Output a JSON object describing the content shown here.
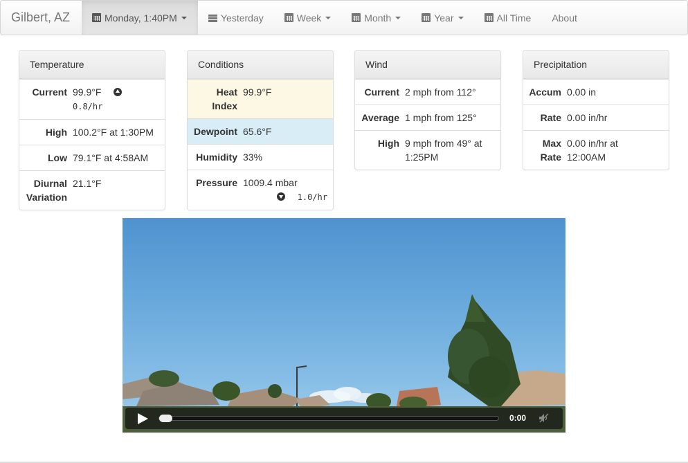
{
  "navbar": {
    "brand": "Gilbert, AZ",
    "items": [
      {
        "label": "Monday, 1:40PM",
        "icon": "calendar-icon",
        "dropdown": true,
        "active": true
      },
      {
        "label": "Yesterday",
        "icon": "list-icon",
        "dropdown": false
      },
      {
        "label": "Week",
        "icon": "calendar-icon",
        "dropdown": true
      },
      {
        "label": "Month",
        "icon": "calendar-icon",
        "dropdown": true
      },
      {
        "label": "Year",
        "icon": "calendar-icon",
        "dropdown": true
      },
      {
        "label": "All Time",
        "icon": "calendar-icon",
        "dropdown": false
      },
      {
        "label": "About",
        "dropdown": false
      }
    ]
  },
  "temperature": {
    "title": "Temperature",
    "current_label": "Current",
    "current_value": "99.9°F",
    "current_trend": "0.8/hr",
    "current_trend_direction": "up",
    "high_label": "High",
    "high_value": "100.2°F at 1:30PM",
    "low_label": "Low",
    "low_value": "79.1°F at 4:58AM",
    "diurnal_label_1": "Diurnal",
    "diurnal_label_2": "Variation",
    "diurnal_value": "21.1°F"
  },
  "conditions": {
    "title": "Conditions",
    "heat_label_1": "Heat",
    "heat_label_2": "Index",
    "heat_value": "99.9°F",
    "dewpoint_label": "Dewpoint",
    "dewpoint_value": "65.6°F",
    "humidity_label": "Humidity",
    "humidity_value": "33%",
    "pressure_label": "Pressure",
    "pressure_value": "1009.4 mbar",
    "pressure_trend": "1.0/hr",
    "pressure_trend_direction": "down",
    "highlight_colors": {
      "heat_index": "#fcf8e3",
      "dewpoint": "#d9edf7"
    }
  },
  "wind": {
    "title": "Wind",
    "current_label": "Current",
    "current_value": "2 mph from 112°",
    "average_label": "Average",
    "average_value": "1 mph from 125°",
    "high_label": "High",
    "high_value_1": "9 mph from 49° at",
    "high_value_2": "1:25PM"
  },
  "precipitation": {
    "title": "Precipitation",
    "accum_label": "Accum",
    "accum_value": "0.00 in",
    "rate_label": "Rate",
    "rate_value": "0.00 in/hr",
    "max_label_1": "Max",
    "max_label_2": "Rate",
    "max_value_1": "0.00 in/hr at",
    "max_value_2": "12:00AM"
  },
  "video": {
    "time": "0:00",
    "progress": 0,
    "muted": true
  }
}
